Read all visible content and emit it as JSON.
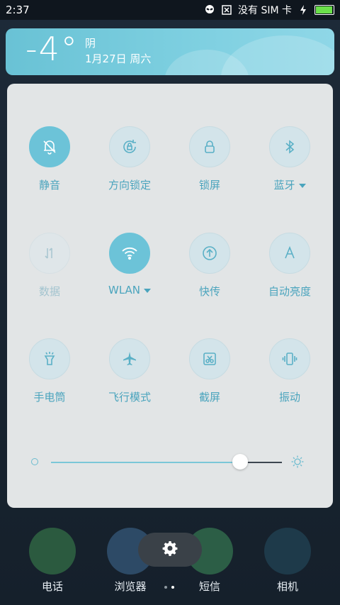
{
  "status_bar": {
    "time": "2:37",
    "sim_text": "没有 SIM 卡",
    "icons": [
      "alien-icon",
      "sim-x-icon",
      "charging-icon",
      "battery-icon"
    ]
  },
  "weather": {
    "temperature": "-4°",
    "condition": "阴",
    "date": "1月27日 周六"
  },
  "quick_settings": [
    {
      "id": "mute",
      "label": "静音",
      "icon": "bell-off-icon",
      "active": true
    },
    {
      "id": "rotation-lock",
      "label": "方向锁定",
      "icon": "rotation-lock-icon",
      "active": false
    },
    {
      "id": "lock-screen",
      "label": "锁屏",
      "icon": "lock-icon",
      "active": false
    },
    {
      "id": "bluetooth",
      "label": "蓝牙",
      "icon": "bluetooth-icon",
      "active": false,
      "dropdown": true
    },
    {
      "id": "data",
      "label": "数据",
      "icon": "data-arrows-icon",
      "active": false,
      "disabled": true
    },
    {
      "id": "wlan",
      "label": "WLAN",
      "icon": "wifi-icon",
      "active": true,
      "dropdown": true
    },
    {
      "id": "quick-transfer",
      "label": "快传",
      "icon": "upload-icon",
      "active": false
    },
    {
      "id": "auto-brightness",
      "label": "自动亮度",
      "icon": "letter-a-icon",
      "active": false
    },
    {
      "id": "flashlight",
      "label": "手电筒",
      "icon": "flashlight-icon",
      "active": false
    },
    {
      "id": "airplane",
      "label": "飞行模式",
      "icon": "airplane-icon",
      "active": false
    },
    {
      "id": "screenshot",
      "label": "截屏",
      "icon": "scissors-icon",
      "active": false
    },
    {
      "id": "vibrate",
      "label": "振动",
      "icon": "vibrate-icon",
      "active": false
    }
  ],
  "brightness": {
    "level": 0.82
  },
  "dock_apps": [
    {
      "label": "电话"
    },
    {
      "label": "浏览器"
    },
    {
      "label": "短信"
    },
    {
      "label": "相机"
    }
  ],
  "page_indicator": {
    "count": 2,
    "current": 1
  },
  "colors": {
    "accent": "#6cc3d8",
    "label": "#4aa4bd",
    "panel": "#e9ebec",
    "weather": "#7dcfe0"
  }
}
